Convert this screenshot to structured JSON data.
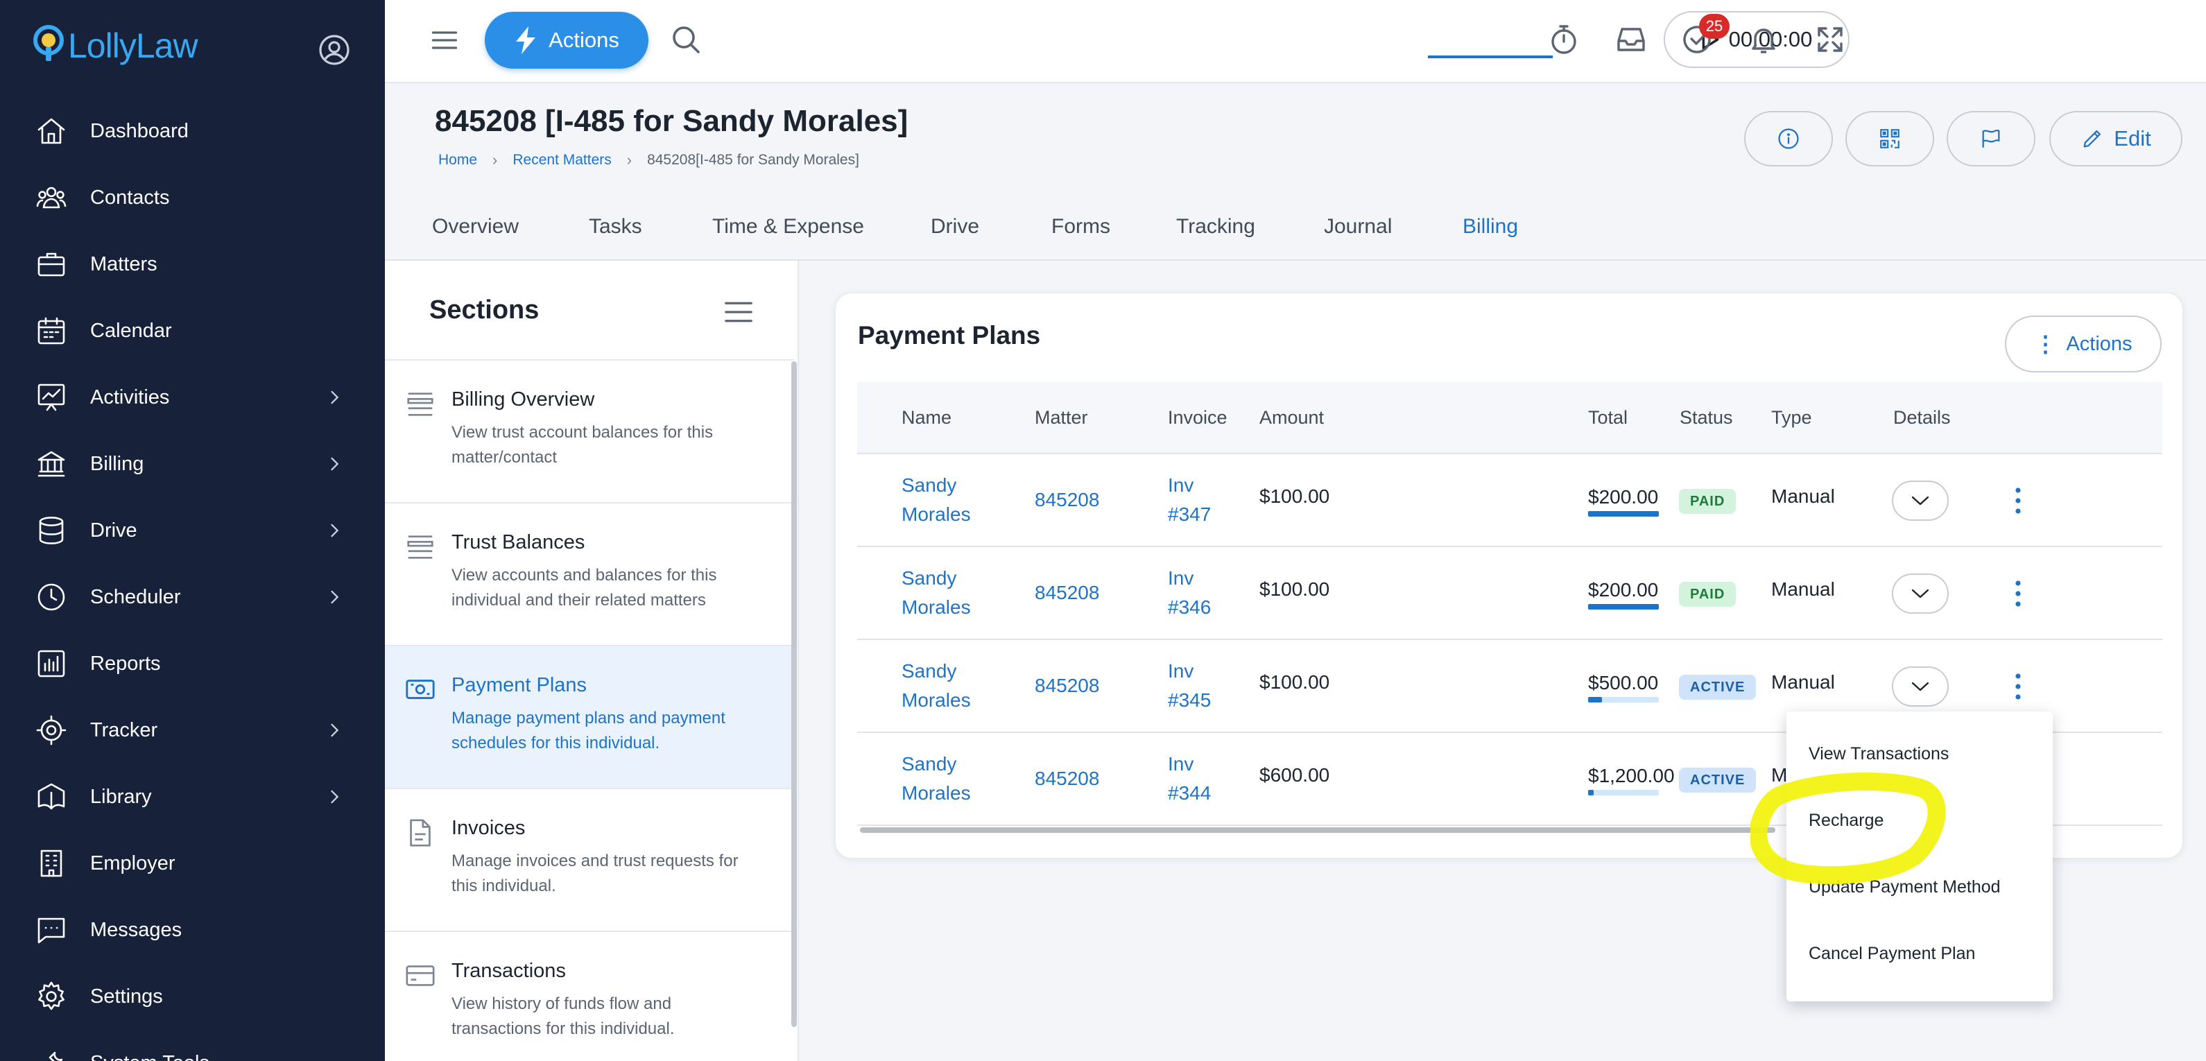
{
  "app": {
    "logo_text": "LollyLaw",
    "accent_color": "#2b8fe8",
    "nav_bg": "#17213a"
  },
  "nav": {
    "items": [
      {
        "label": "Dashboard",
        "icon": "home-icon",
        "has_submenu": false
      },
      {
        "label": "Contacts",
        "icon": "contacts-icon",
        "has_submenu": false
      },
      {
        "label": "Matters",
        "icon": "briefcase-icon",
        "has_submenu": false
      },
      {
        "label": "Calendar",
        "icon": "calendar-icon",
        "has_submenu": false
      },
      {
        "label": "Activities",
        "icon": "activities-chart-icon",
        "has_submenu": true
      },
      {
        "label": "Billing",
        "icon": "bank-icon",
        "has_submenu": true
      },
      {
        "label": "Drive",
        "icon": "database-icon",
        "has_submenu": true
      },
      {
        "label": "Scheduler",
        "icon": "clock-icon",
        "has_submenu": true
      },
      {
        "label": "Reports",
        "icon": "bar-chart-icon",
        "has_submenu": false
      },
      {
        "label": "Tracker",
        "icon": "target-icon",
        "has_submenu": true
      },
      {
        "label": "Library",
        "icon": "library-icon",
        "has_submenu": true
      },
      {
        "label": "Employer",
        "icon": "building-icon",
        "has_submenu": false
      },
      {
        "label": "Messages",
        "icon": "message-icon",
        "has_submenu": false
      },
      {
        "label": "Settings",
        "icon": "gear-icon",
        "has_submenu": false
      },
      {
        "label": "System Tools",
        "icon": "tools-icon",
        "has_submenu": false
      }
    ]
  },
  "topbar": {
    "actions_label": "Actions",
    "timer_value": "00:00:00",
    "notification_count": "25"
  },
  "matter": {
    "title": "845208 [I-485 for Sandy Morales]",
    "breadcrumb": [
      "Home",
      "Recent Matters",
      "845208[I-485 for Sandy Morales]"
    ],
    "edit_label": "Edit"
  },
  "tabs": [
    "Overview",
    "Tasks",
    "Time & Expense",
    "Drive",
    "Forms",
    "Tracking",
    "Journal",
    "Billing"
  ],
  "active_tab": "Billing",
  "sections": {
    "title": "Sections",
    "items": [
      {
        "title": "Billing Overview",
        "desc": "View trust account balances for this matter/contact",
        "icon": "list-icon"
      },
      {
        "title": "Trust Balances",
        "desc": "View accounts and balances for this individual and their related matters",
        "icon": "list-icon"
      },
      {
        "title": "Payment Plans",
        "desc": "Manage payment plans and payment schedules for this individual.",
        "icon": "money-icon"
      },
      {
        "title": "Invoices",
        "desc": "Manage invoices and trust requests for this individual.",
        "icon": "document-icon"
      },
      {
        "title": "Transactions",
        "desc": "View history of funds flow and transactions for this individual.",
        "icon": "card-icon"
      }
    ],
    "active_index": 2
  },
  "payment_plans": {
    "title": "Payment Plans",
    "actions_label": "Actions",
    "columns": [
      "Name",
      "Matter",
      "Invoice",
      "Amount",
      "Total",
      "Status",
      "Type",
      "Details"
    ],
    "rows": [
      {
        "name_1": "Sandy",
        "name_2": "Morales",
        "matter": "845208",
        "inv_1": "Inv",
        "inv_2": "#347",
        "amount": "$100.00",
        "total": "$200.00",
        "paid_fraction": 1.0,
        "status": "PAID",
        "type": "Manual"
      },
      {
        "name_1": "Sandy",
        "name_2": "Morales",
        "matter": "845208",
        "inv_1": "Inv",
        "inv_2": "#346",
        "amount": "$100.00",
        "total": "$200.00",
        "paid_fraction": 1.0,
        "status": "PAID",
        "type": "Manual"
      },
      {
        "name_1": "Sandy",
        "name_2": "Morales",
        "matter": "845208",
        "inv_1": "Inv",
        "inv_2": "#345",
        "amount": "$100.00",
        "total": "$500.00",
        "paid_fraction": 0.2,
        "status": "ACTIVE",
        "type": "Manual"
      },
      {
        "name_1": "Sandy",
        "name_2": "Morales",
        "matter": "845208",
        "inv_1": "Inv",
        "inv_2": "#344",
        "amount": "$600.00",
        "total": "$1,200.00",
        "paid_fraction": 0.08,
        "status": "ACTIVE",
        "type": "M"
      }
    ]
  },
  "row_menu": {
    "items": [
      "View Transactions",
      "Recharge",
      "Update Payment Method",
      "Cancel Payment Plan"
    ],
    "highlighted": "Recharge",
    "highlight_color": "#f2f20a"
  }
}
